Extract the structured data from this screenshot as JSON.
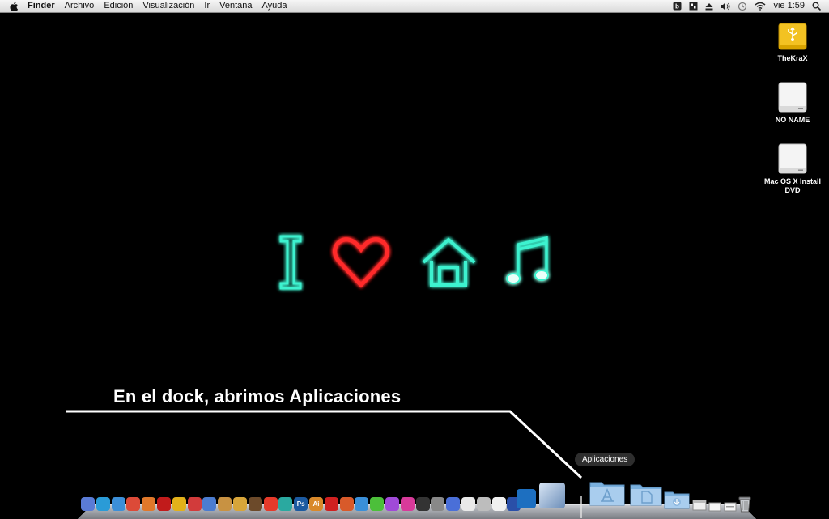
{
  "menubar": {
    "app_name": "Finder",
    "menus": [
      "Archivo",
      "Edición",
      "Visualización",
      "Ir",
      "Ventana",
      "Ayuda"
    ],
    "clock": "vie 1:59",
    "status_icons": [
      "bluetooth-b-icon",
      "text-input-icon",
      "eject-icon",
      "volume-icon",
      "time-machine-icon",
      "wifi-icon",
      "spotlight-icon"
    ]
  },
  "desktop_icons": [
    {
      "label": "TheKraX",
      "icon": "usb-drive-icon"
    },
    {
      "label": "NO NAME",
      "icon": "external-drive-icon"
    },
    {
      "label": "Mac OS X Install DVD",
      "icon": "install-dvd-icon"
    }
  ],
  "wallpaper": {
    "glyphs": [
      "I",
      "heart",
      "house",
      "music-note"
    ],
    "colors": {
      "teal": "#3cf2cf",
      "red": "#ff2a2a"
    }
  },
  "annotation": {
    "text": "En el dock, abrimos Aplicaciones"
  },
  "dock": {
    "tooltip": "Aplicaciones",
    "folders": [
      "applications-folder-icon",
      "documents-folder-icon",
      "downloads-folder-icon"
    ]
  }
}
